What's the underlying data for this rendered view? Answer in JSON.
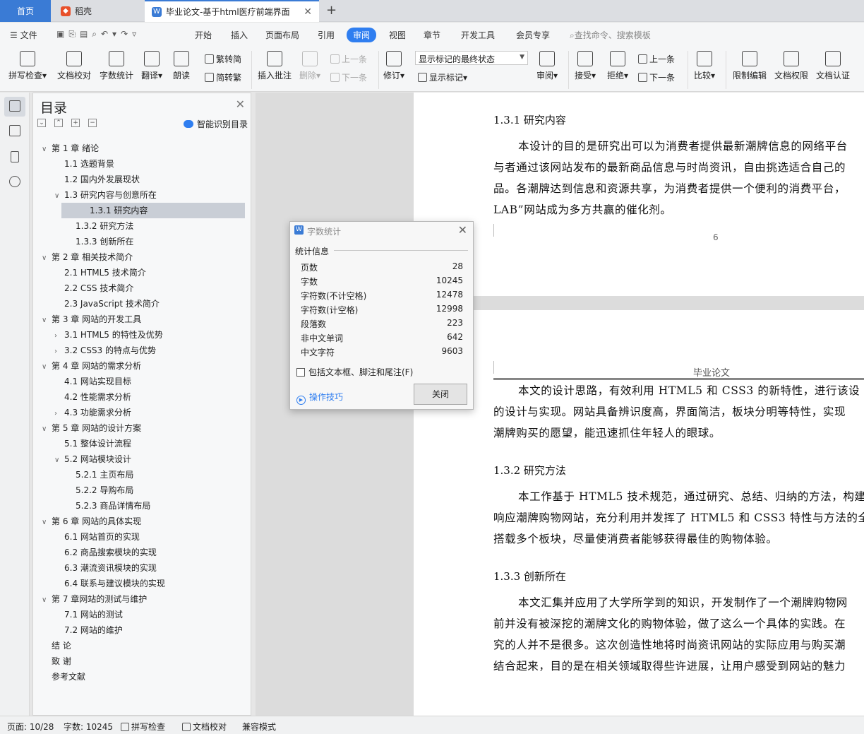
{
  "tabs": {
    "home": "首页",
    "daoke": "稻壳",
    "doc": "毕业论文-基于html医疗前端界面"
  },
  "menu": {
    "file": "文件",
    "items": [
      "开始",
      "插入",
      "页面布局",
      "引用",
      "审阅",
      "视图",
      "章节",
      "开发工具",
      "会员专享"
    ],
    "search": "查找命令、搜索模板"
  },
  "ribbon": {
    "spell": "拼写检查",
    "doc_check": "文档校对",
    "word_count": "字数统计",
    "translate": "翻译",
    "read": "朗读",
    "to_trad": "繁转简",
    "to_simp": "简转繁",
    "insert_comment": "插入批注",
    "delete": "删除",
    "prev": "上一条",
    "next": "下一条",
    "track": "修订",
    "markup_select": "显示标记的最终状态",
    "show_markup": "显示标记",
    "review": "审阅",
    "accept": "接受",
    "reject": "拒绝",
    "prev2": "上一条",
    "next2": "下一条",
    "compare": "比较",
    "restrict": "限制编辑",
    "permission": "文档权限",
    "certify": "文档认证"
  },
  "toc": {
    "title": "目录",
    "smart": "智能识别目录",
    "items": [
      {
        "label": "第 1 章  绪论",
        "level": 1,
        "chev": "v"
      },
      {
        "label": "1.1  选题背景",
        "level": 2,
        "chev": ""
      },
      {
        "label": "1.2  国内外发展现状",
        "level": 2,
        "chev": ""
      },
      {
        "label": "1.3  研究内容与创意所在",
        "level": 2,
        "chev": "v"
      },
      {
        "label": "1.3.1  研究内容",
        "level": 3,
        "chev": "",
        "selected": true
      },
      {
        "label": "1.3.2  研究方法",
        "level": 3,
        "chev": ""
      },
      {
        "label": "1.3.3  创新所在",
        "level": 3,
        "chev": ""
      },
      {
        "label": "第 2 章  相关技术简介",
        "level": 1,
        "chev": "v"
      },
      {
        "label": "2.1 HTML5 技术简介",
        "level": 2,
        "chev": ""
      },
      {
        "label": "2.2 CSS 技术简介",
        "level": 2,
        "chev": ""
      },
      {
        "label": "2.3 JavaScript 技术简介",
        "level": 2,
        "chev": ""
      },
      {
        "label": "第 3 章  网站的开发工具",
        "level": 1,
        "chev": "v"
      },
      {
        "label": "3.1 HTML5 的特性及优势",
        "level": 2,
        "chev": ">"
      },
      {
        "label": "3.2 CSS3 的特点与优势",
        "level": 2,
        "chev": ">"
      },
      {
        "label": "第 4 章  网站的需求分析",
        "level": 1,
        "chev": "v"
      },
      {
        "label": "4.1  网站实现目标",
        "level": 2,
        "chev": ""
      },
      {
        "label": "4.2  性能需求分析",
        "level": 2,
        "chev": ""
      },
      {
        "label": "4.3  功能需求分析",
        "level": 2,
        "chev": ">"
      },
      {
        "label": "第 5 章  网站的设计方案",
        "level": 1,
        "chev": "v"
      },
      {
        "label": "5.1  整体设计流程",
        "level": 2,
        "chev": ""
      },
      {
        "label": "5.2  网站模块设计",
        "level": 2,
        "chev": "v"
      },
      {
        "label": "5.2.1  主页布局",
        "level": 3,
        "chev": ""
      },
      {
        "label": "5.2.2  导购布局",
        "level": 3,
        "chev": ""
      },
      {
        "label": "5.2.3  商品详情布局",
        "level": 3,
        "chev": ""
      },
      {
        "label": "第 6 章  网站的具体实现",
        "level": 1,
        "chev": "v"
      },
      {
        "label": "6.1  网站首页的实现",
        "level": 2,
        "chev": ""
      },
      {
        "label": "6.2  商品搜索模块的实现",
        "level": 2,
        "chev": ""
      },
      {
        "label": "6.3  潮流资讯模块的实现",
        "level": 2,
        "chev": ""
      },
      {
        "label": "6.4  联系与建议模块的实现",
        "level": 2,
        "chev": ""
      },
      {
        "label": "第 7 章网站的测试与维护",
        "level": 1,
        "chev": "v"
      },
      {
        "label": "7.1  网站的测试",
        "level": 2,
        "chev": ""
      },
      {
        "label": "7.2  网站的维护",
        "level": 2,
        "chev": ""
      },
      {
        "label": "结    论",
        "level": 1,
        "chev": ""
      },
      {
        "label": "致    谢",
        "level": 1,
        "chev": ""
      },
      {
        "label": "参考文献",
        "level": 1,
        "chev": ""
      }
    ]
  },
  "document": {
    "h_131": "1.3.1  研究内容",
    "p1": [
      "本设计的目的是研究出可以为消费者提供最新潮牌信息的网络平台",
      "与者通过该网站发布的最新商品信息与时尚资讯，自由挑选适合自己的",
      "品。各潮牌达到信息和资源共享，为消费者提供一个便利的消费平台，",
      "LAB”网站成为多方共赢的催化剂。"
    ],
    "page_number": "6",
    "header_text": "毕业论文",
    "p2": [
      "本文的设计思路，有效利用 HTML5 和 CSS3 的新特性，进行该设",
      "的设计与实现。网站具备辨识度高，界面简洁，板块分明等特性，实现",
      "潮牌购买的愿望，能迅速抓住年轻人的眼球。"
    ],
    "h_132": "1.3.2  研究方法",
    "p3": [
      "本工作基于 HTML5 技术规范，通过研究、总结、归纳的方法，构建",
      "响应潮牌购物网站，充分利用并发挥了 HTML5 和 CSS3 特性与方法的全",
      "搭载多个板块，尽量使消费者能够获得最佳的购物体验。"
    ],
    "h_133": "1.3.3  创新所在",
    "p4": [
      "本文汇集并应用了大学所学到的知识，开发制作了一个潮牌购物网",
      "前并没有被深挖的潮牌文化的购物体验，做了这么一个具体的实践。在",
      "究的人并不是很多。这次创造性地将时尚资讯网站的实际应用与购买潮",
      "结合起来，目的是在相关领域取得些许进展，让用户感受到网站的魅力"
    ]
  },
  "dialog": {
    "title": "字数统计",
    "section": "统计信息",
    "stats": [
      {
        "label": "页数",
        "value": "28"
      },
      {
        "label": "字数",
        "value": "10245"
      },
      {
        "label": "字符数(不计空格)",
        "value": "12478"
      },
      {
        "label": "字符数(计空格)",
        "value": "12998"
      },
      {
        "label": "段落数",
        "value": "223"
      },
      {
        "label": "非中文单词",
        "value": "642"
      },
      {
        "label": "中文字符",
        "value": "9603"
      }
    ],
    "include_label": "包括文本框、脚注和尾注(F)",
    "tips": "操作技巧",
    "close": "关闭"
  },
  "status": {
    "page": "页面: 10/28",
    "words": "字数: 10245",
    "spell": "拼写检查",
    "proof": "文档校对",
    "compat": "兼容模式"
  },
  "colors": {
    "accent": "#2f7ef0",
    "tab_home": "#3a7bd5",
    "daoke": "#e8502a"
  }
}
